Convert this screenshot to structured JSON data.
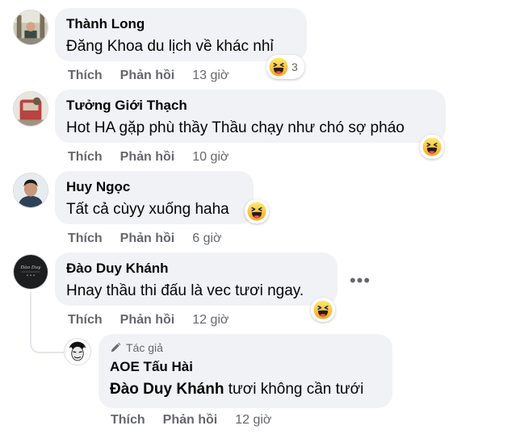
{
  "comments": [
    {
      "author": "Thành Long",
      "text": "Đăng Khoa du lịch về khác nhỉ",
      "like_label": "Thích",
      "reply_label": "Phản hồi",
      "time": "13 giờ",
      "reaction": {
        "icon": "haha-emoji-icon",
        "count": "3"
      }
    },
    {
      "author": "Tưởng Giới Thạch",
      "text": "Hot HA gặp phù thầy Thầu chạy như chó sợ pháo",
      "like_label": "Thích",
      "reply_label": "Phản hồi",
      "time": "10 giờ",
      "reaction": {
        "icon": "haha-emoji-icon"
      }
    },
    {
      "author": "Huy Ngọc",
      "text": "Tất cả cùyy xuống haha",
      "like_label": "Thích",
      "reply_label": "Phản hồi",
      "time": "6 giờ",
      "reaction": {
        "icon": "haha-emoji-icon"
      }
    },
    {
      "author": "Đào Duy Khánh",
      "text": "Hnay thầu thi đấu là vec tươi ngay.",
      "like_label": "Thích",
      "reply_label": "Phản hồi",
      "time": "12 giờ",
      "more_icon": "more-options-icon",
      "reaction": {
        "icon": "haha-emoji-icon"
      }
    }
  ],
  "reply": {
    "author_badge": "Tác giả",
    "author_badge_icon": "pencil-icon",
    "author": "AOE Tấu Hài",
    "mention": "Đào Duy Khánh",
    "text": " tươi không cần tưới",
    "like_label": "Thích",
    "reply_label": "Phản hồi",
    "time": "12 giờ"
  },
  "colors": {
    "bubble": "#f0f2f5",
    "secondary_text": "#65676b",
    "haha_face": "#f7b125",
    "haha_mouth": "#e5352a"
  }
}
